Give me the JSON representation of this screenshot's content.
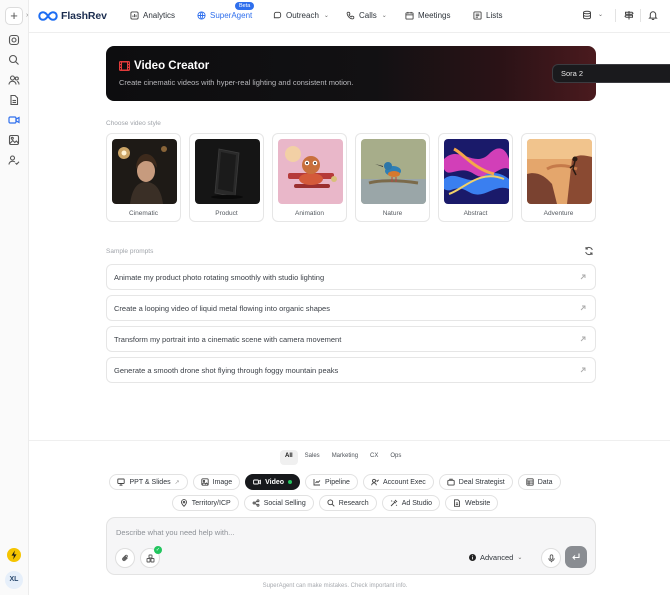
{
  "app": {
    "name": "FlashRev"
  },
  "nav": {
    "items": [
      {
        "label": "Analytics",
        "icon": "analytics-icon"
      },
      {
        "label": "SuperAgent",
        "icon": "superagent-icon",
        "active": true,
        "badge": "Beta"
      },
      {
        "label": "Outreach",
        "icon": "outreach-icon",
        "dropdown": true
      },
      {
        "label": "Calls",
        "icon": "phone-icon",
        "dropdown": true
      },
      {
        "label": "Meetings",
        "icon": "meetings-icon"
      },
      {
        "label": "Lists",
        "icon": "lists-icon"
      }
    ]
  },
  "hero": {
    "title": "Video Creator",
    "subtitle": "Create cinematic videos with hyper-real lighting and consistent motion.",
    "model": "Sora 2"
  },
  "styles": {
    "label": "Choose video style",
    "items": [
      {
        "label": "Cinematic"
      },
      {
        "label": "Product"
      },
      {
        "label": "Animation"
      },
      {
        "label": "Nature"
      },
      {
        "label": "Abstract"
      },
      {
        "label": "Adventure"
      }
    ]
  },
  "prompts": {
    "label": "Sample prompts",
    "items": [
      "Animate my product photo rotating smoothly with studio lighting",
      "Create a looping video of liquid metal flowing into organic shapes",
      "Transform my portrait into a cinematic scene with camera movement",
      "Generate a smooth drone shot flying through foggy mountain peaks"
    ]
  },
  "categories": [
    "All",
    "Sales",
    "Marketing",
    "CX",
    "Ops"
  ],
  "tools": {
    "row1": [
      {
        "label": "PPT & Slides",
        "icon": "slides-icon",
        "external": true
      },
      {
        "label": "Image",
        "icon": "image-icon"
      },
      {
        "label": "Video",
        "icon": "video-icon",
        "active": true
      },
      {
        "label": "Pipeline",
        "icon": "pipeline-icon"
      },
      {
        "label": "Account Exec",
        "icon": "account-exec-icon"
      },
      {
        "label": "Deal Strategist",
        "icon": "deal-strategist-icon"
      },
      {
        "label": "Data",
        "icon": "data-icon"
      }
    ],
    "row2": [
      {
        "label": "Territory/ICP",
        "icon": "territory-icon"
      },
      {
        "label": "Social Selling",
        "icon": "social-selling-icon"
      },
      {
        "label": "Research",
        "icon": "research-icon"
      },
      {
        "label": "Ad Studio",
        "icon": "ad-studio-icon"
      },
      {
        "label": "Website",
        "icon": "website-icon"
      }
    ]
  },
  "composer": {
    "placeholder": "Describe what you need help with...",
    "mode": "Advanced"
  },
  "disclaimer": "SuperAgent can make mistakes. Check important info.",
  "user": {
    "initials": "XL"
  },
  "colors": {
    "accent": "#2f6fed",
    "success": "#22c55e",
    "hero_dark": "#0d0d0f",
    "hero_red": "#4a1a1e"
  }
}
